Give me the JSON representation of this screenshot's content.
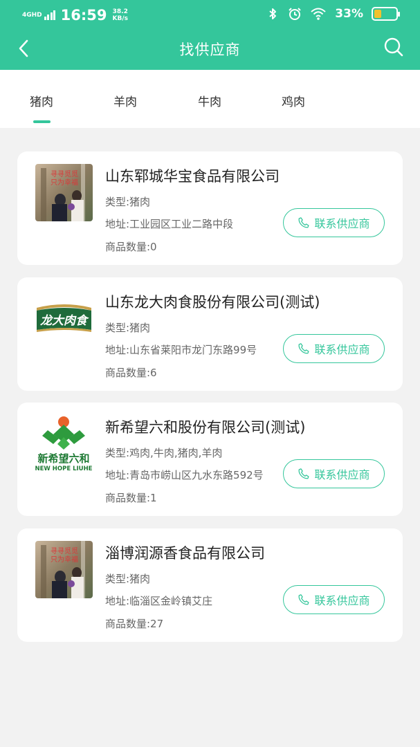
{
  "status_bar": {
    "network": "4GHD",
    "time": "16:59",
    "speed_value": "38.2",
    "speed_unit": "KB/s",
    "battery_percent": "33%",
    "battery_level": 0.33,
    "icons": [
      "signal-icon",
      "bluetooth-icon",
      "alarm-icon",
      "wifi-icon",
      "battery-icon"
    ]
  },
  "header": {
    "title": "找供应商",
    "back_icon": "chevron-left-icon",
    "search_icon": "search-icon",
    "background": "#34c69b"
  },
  "tabs": [
    {
      "label": "猪肉",
      "selected": true
    },
    {
      "label": "羊肉",
      "selected": false
    },
    {
      "label": "牛肉",
      "selected": false
    },
    {
      "label": "鸡肉",
      "selected": false
    }
  ],
  "accent_color": "#34c69b",
  "suppliers": [
    {
      "name": "山东郓城华宝食品有限公司",
      "type": "类型:猪肉",
      "address": "地址:工业园区工业二路中段",
      "count": "商品数量:0",
      "logo": "photo-logo",
      "logo_text": "寻寻觅觅 只为幸福",
      "contact_label": "联系供应商"
    },
    {
      "name": "山东龙大肉食股份有限公司(测试)",
      "type": "类型:猪肉",
      "address": "地址:山东省莱阳市龙门东路99号",
      "count": "商品数量:6",
      "logo": "longda-logo",
      "logo_text": "龙大肉食",
      "contact_label": "联系供应商"
    },
    {
      "name": "新希望六和股份有限公司(测试)",
      "type": "类型:鸡肉,牛肉,猪肉,羊肉",
      "address": "地址:青岛市崂山区九水东路592号",
      "count": "商品数量:1",
      "logo": "newhope-logo",
      "logo_text": "新希望六和",
      "logo_subtext": "NEW HOPE LIUHE",
      "contact_label": "联系供应商"
    },
    {
      "name": "淄博润源香食品有限公司",
      "type": "类型:猪肉",
      "address": "地址:临淄区金岭镇艾庄",
      "count": "商品数量:27",
      "logo": "photo-logo",
      "logo_text": "寻寻觅觅 只为幸福",
      "contact_label": "联系供应商"
    }
  ]
}
